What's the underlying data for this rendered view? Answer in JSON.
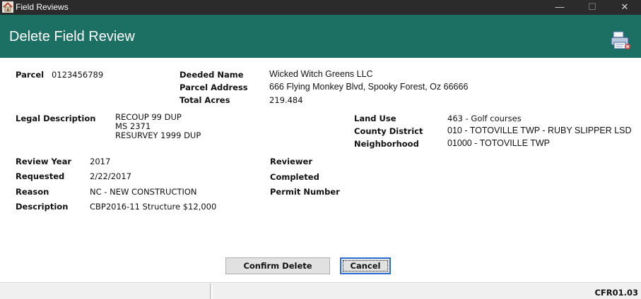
{
  "window": {
    "title": "Field Reviews",
    "controls": {
      "minimize": "—",
      "maximize": "☐",
      "close": "✕"
    }
  },
  "header": {
    "title": "Delete Field Review",
    "icon": "printer-icon"
  },
  "parcel": {
    "label": "Parcel",
    "value": "0123456789"
  },
  "owner": {
    "deeded_name_label": "Deeded Name",
    "deeded_name": "Wicked Witch Greens LLC",
    "parcel_address_label": "Parcel Address",
    "parcel_address": "666 Flying Monkey Blvd, Spooky Forest, Oz 66666",
    "total_acres_label": "Total Acres",
    "total_acres": "219.484"
  },
  "legal": {
    "label": "Legal Description",
    "lines": [
      "RECOUP 99 DUP",
      "MS 2371",
      "RESURVEY 1999 DUP"
    ]
  },
  "land": {
    "land_use_label": "Land Use",
    "land_use": "463 - Golf courses",
    "county_district_label": "County District",
    "county_district": "010 -  TOTOVILLE TWP - RUBY SLIPPER LSD",
    "neighborhood_label": "Neighborhood",
    "neighborhood": "01000 - TOTOVILLE TWP"
  },
  "review": {
    "review_year_label": "Review Year",
    "review_year": "2017",
    "requested_label": "Requested",
    "requested": "2/22/2017",
    "reason_label": "Reason",
    "reason": "NC - NEW CONSTRUCTION",
    "description_label": "Description",
    "description": "CBP2016-11 Structure $12,000",
    "reviewer_label": "Reviewer",
    "reviewer": "",
    "completed_label": "Completed",
    "completed": "",
    "permit_number_label": "Permit Number",
    "permit_number": ""
  },
  "actions": {
    "confirm_label": "Confirm Delete",
    "cancel_label": "Cancel"
  },
  "statusbar": {
    "left_text": "",
    "code": "CFR01.03"
  },
  "colors": {
    "header_bg": "#1b6f63",
    "titlebar_bg": "#2b2b2b",
    "focus_border": "#2a6fd1"
  }
}
